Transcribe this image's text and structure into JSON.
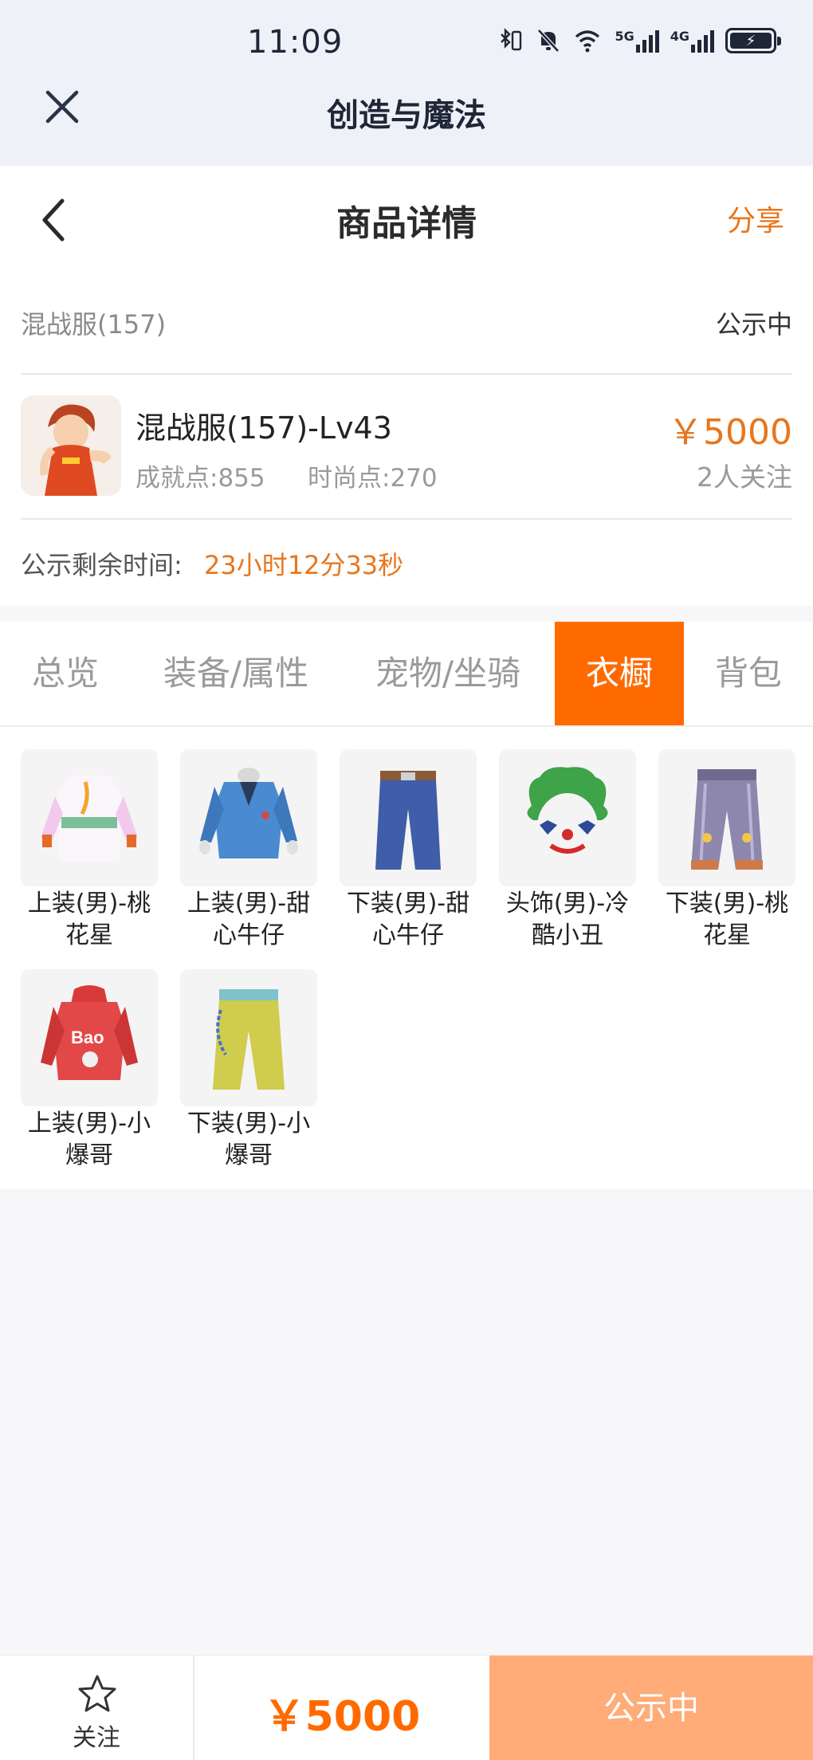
{
  "status_bar": {
    "time": "11:09",
    "net1": "5G",
    "net2": "4G"
  },
  "app": {
    "title": "创造与魔法"
  },
  "page": {
    "title": "商品详情",
    "share": "分享"
  },
  "product": {
    "short_name": "混战服(157)",
    "status": "公示中",
    "title": "混战服(157)-Lv43",
    "achievement": "成就点:855",
    "fashion": "时尚点:270",
    "price": "￥5000",
    "followers": "2人关注",
    "remain_label": "公示剩余时间:",
    "remain_value": "23小时12分33秒"
  },
  "tabs": [
    "总览",
    "装备/属性",
    "宠物/坐骑",
    "衣橱",
    "背包"
  ],
  "active_tab": "衣橱",
  "wardrobe": [
    {
      "name": "上装(男)-桃花星",
      "icon": "pink-white-top-icon"
    },
    {
      "name": "上装(男)-甜心牛仔",
      "icon": "denim-jacket-icon"
    },
    {
      "name": "下装(男)-甜心牛仔",
      "icon": "jeans-icon"
    },
    {
      "name": "头饰(男)-冷酷小丑",
      "icon": "clown-mask-icon"
    },
    {
      "name": "下装(男)-桃花星",
      "icon": "striped-pants-icon"
    },
    {
      "name": "上装(男)-小爆哥",
      "icon": "red-hoodie-icon"
    },
    {
      "name": "下装(男)-小爆哥",
      "icon": "yellow-pants-icon"
    }
  ],
  "bottom_bar": {
    "follow": "关注",
    "price": "￥5000",
    "status": "公示中"
  },
  "colors": {
    "accent": "#ff6a00",
    "price": "#e8761c",
    "disabled_button": "#ffac78",
    "header_bg": "#eef1f7"
  }
}
